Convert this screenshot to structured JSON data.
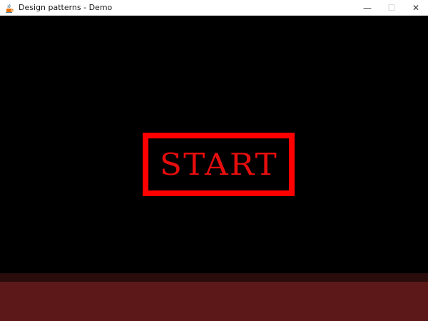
{
  "window": {
    "title": "Design patterns - Demo",
    "icon": "java-cup-icon",
    "controls": {
      "minimize": "—",
      "maximize": "☐",
      "close": "✕"
    }
  },
  "game": {
    "start_label": "START",
    "colors": {
      "background": "#000000",
      "button_border": "#ff0000",
      "button_text": "#e60d0d",
      "floor": "#5c1818",
      "floor_edge": "#2a0c0c"
    }
  }
}
